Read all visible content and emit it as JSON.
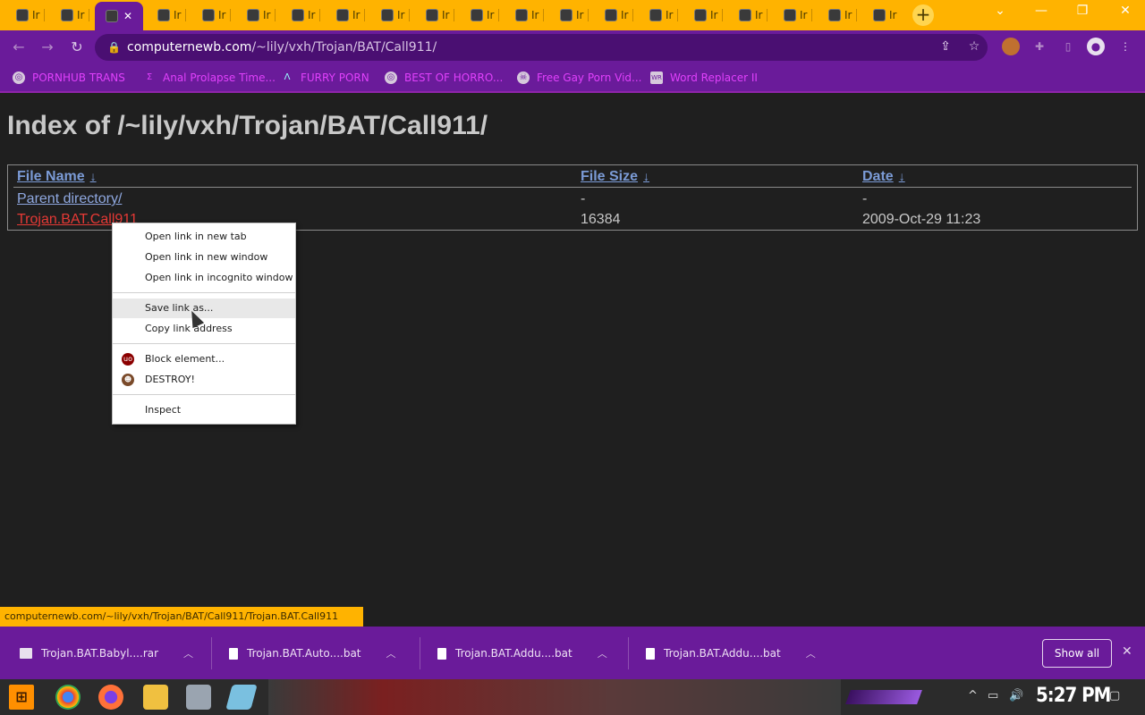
{
  "browser": {
    "tab_title": "Ir",
    "address_host": "computernewb.com",
    "address_path": "/~lily/vxh/Trojan/BAT/Call911/",
    "bookmarks": [
      {
        "label": "PORNHUB TRANS",
        "icon": "globe-icon"
      },
      {
        "label": "Anal Prolapse Time...",
        "icon": "sigma-icon"
      },
      {
        "label": "FURRY PORN",
        "icon": "lambda-icon"
      },
      {
        "label": "BEST OF HORRO...",
        "icon": "globe-icon"
      },
      {
        "label": "Free Gay Porn Vid...",
        "icon": "skull-icon"
      },
      {
        "label": "Word Replacer II",
        "icon": "wr-icon"
      }
    ],
    "colors": {
      "tabstrip": "#ffb300",
      "toolbar": "#6a1b9a"
    }
  },
  "page": {
    "title": "Index of /~lily/vxh/Trojan/BAT/Call911/",
    "columns": [
      {
        "label": "File Name",
        "arrow": "↓"
      },
      {
        "label": "File Size",
        "arrow": "↓"
      },
      {
        "label": "Date",
        "arrow": "↓"
      }
    ],
    "rows": [
      {
        "name": "Parent directory/",
        "size": "-",
        "date": "-"
      },
      {
        "name": "Trojan.BAT.Call911",
        "size": "16384",
        "date": "2009-Oct-29 11:23"
      }
    ]
  },
  "context_menu": {
    "items": [
      {
        "label": "Open link in new tab"
      },
      {
        "label": "Open link in new window"
      },
      {
        "label": "Open link in incognito window"
      },
      {
        "label": "Save link as..."
      },
      {
        "label": "Copy link address"
      },
      {
        "label": "Block element...",
        "icon": "ublock-icon"
      },
      {
        "label": "DESTROY!",
        "icon": "face-icon"
      },
      {
        "label": "Inspect"
      }
    ]
  },
  "status_bubble": "computernewb.com/~lily/vxh/Trojan/BAT/Call911/Trojan.BAT.Call911",
  "downloads": {
    "items": [
      {
        "name": "Trojan.BAT.Babyl....rar"
      },
      {
        "name": "Trojan.BAT.Auto....bat"
      },
      {
        "name": "Trojan.BAT.Addu....bat"
      },
      {
        "name": "Trojan.BAT.Addu....bat"
      }
    ],
    "show_all_label": "Show all"
  },
  "taskbar": {
    "clock": "5:27 PM"
  }
}
